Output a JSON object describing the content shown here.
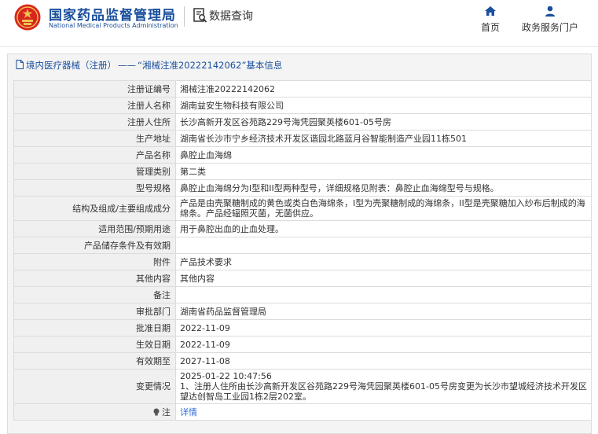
{
  "header": {
    "org_name_cn": "国家药品监督管理局",
    "org_name_en": "National Medical Products Administration",
    "page_title": "数据查询",
    "nav": [
      {
        "label": "首页",
        "icon": "home-icon"
      },
      {
        "label": "政务服务门户",
        "icon": "user-icon"
      }
    ]
  },
  "breadcrumb": {
    "category": "境内医疗器械（注册）",
    "separator": "——",
    "title": "“湘械注准20222142062”基本信息"
  },
  "rows": [
    {
      "label": "注册证编号",
      "value": "湘械注准20222142062"
    },
    {
      "label": "注册人名称",
      "value": "湖南益安生物科技有限公司"
    },
    {
      "label": "注册人住所",
      "value": "长沙高新开发区谷苑路229号海凭园聚英楼601-05号房"
    },
    {
      "label": "生产地址",
      "value": "湖南省长沙市宁乡经济技术开发区谐园北路蓝月谷智能制造产业园11栋501"
    },
    {
      "label": "产品名称",
      "value": "鼻腔止血海绵"
    },
    {
      "label": "管理类别",
      "value": "第二类"
    },
    {
      "label": "型号规格",
      "value": "鼻腔止血海绵分为I型和II型两种型号，详细规格见附表：鼻腔止血海绵型号与规格。"
    },
    {
      "label": "结构及组成/主要组成成分",
      "value": "产品是由壳聚糖制成的黄色或类白色海绵条，I型为壳聚糖制成的海绵条，II型是壳聚糖加入纱布后制成的海绵条。产品经辐照灭菌，无菌供应。"
    },
    {
      "label": "适用范围/预期用途",
      "value": "用于鼻腔出血的止血处理。"
    },
    {
      "label": "产品储存条件及有效期",
      "value": ""
    },
    {
      "label": "附件",
      "value": "产品技术要求"
    },
    {
      "label": "其他内容",
      "value": "其他内容"
    },
    {
      "label": "备注",
      "value": ""
    },
    {
      "label": "审批部门",
      "value": "湖南省药品监督管理局"
    },
    {
      "label": "批准日期",
      "value": "2022-11-09"
    },
    {
      "label": "生效日期",
      "value": "2022-11-09"
    },
    {
      "label": "有效期至",
      "value": "2027-11-08"
    },
    {
      "label": "变更情况",
      "value": "2025-01-22 10:47:56\n1、注册人住所由长沙高新开发区谷苑路229号海凭园聚英楼601-05号房变更为长沙市望城经济技术开发区望达创智岛工业园1栋2层202室。"
    },
    {
      "label": "注",
      "value": "详情"
    }
  ]
}
